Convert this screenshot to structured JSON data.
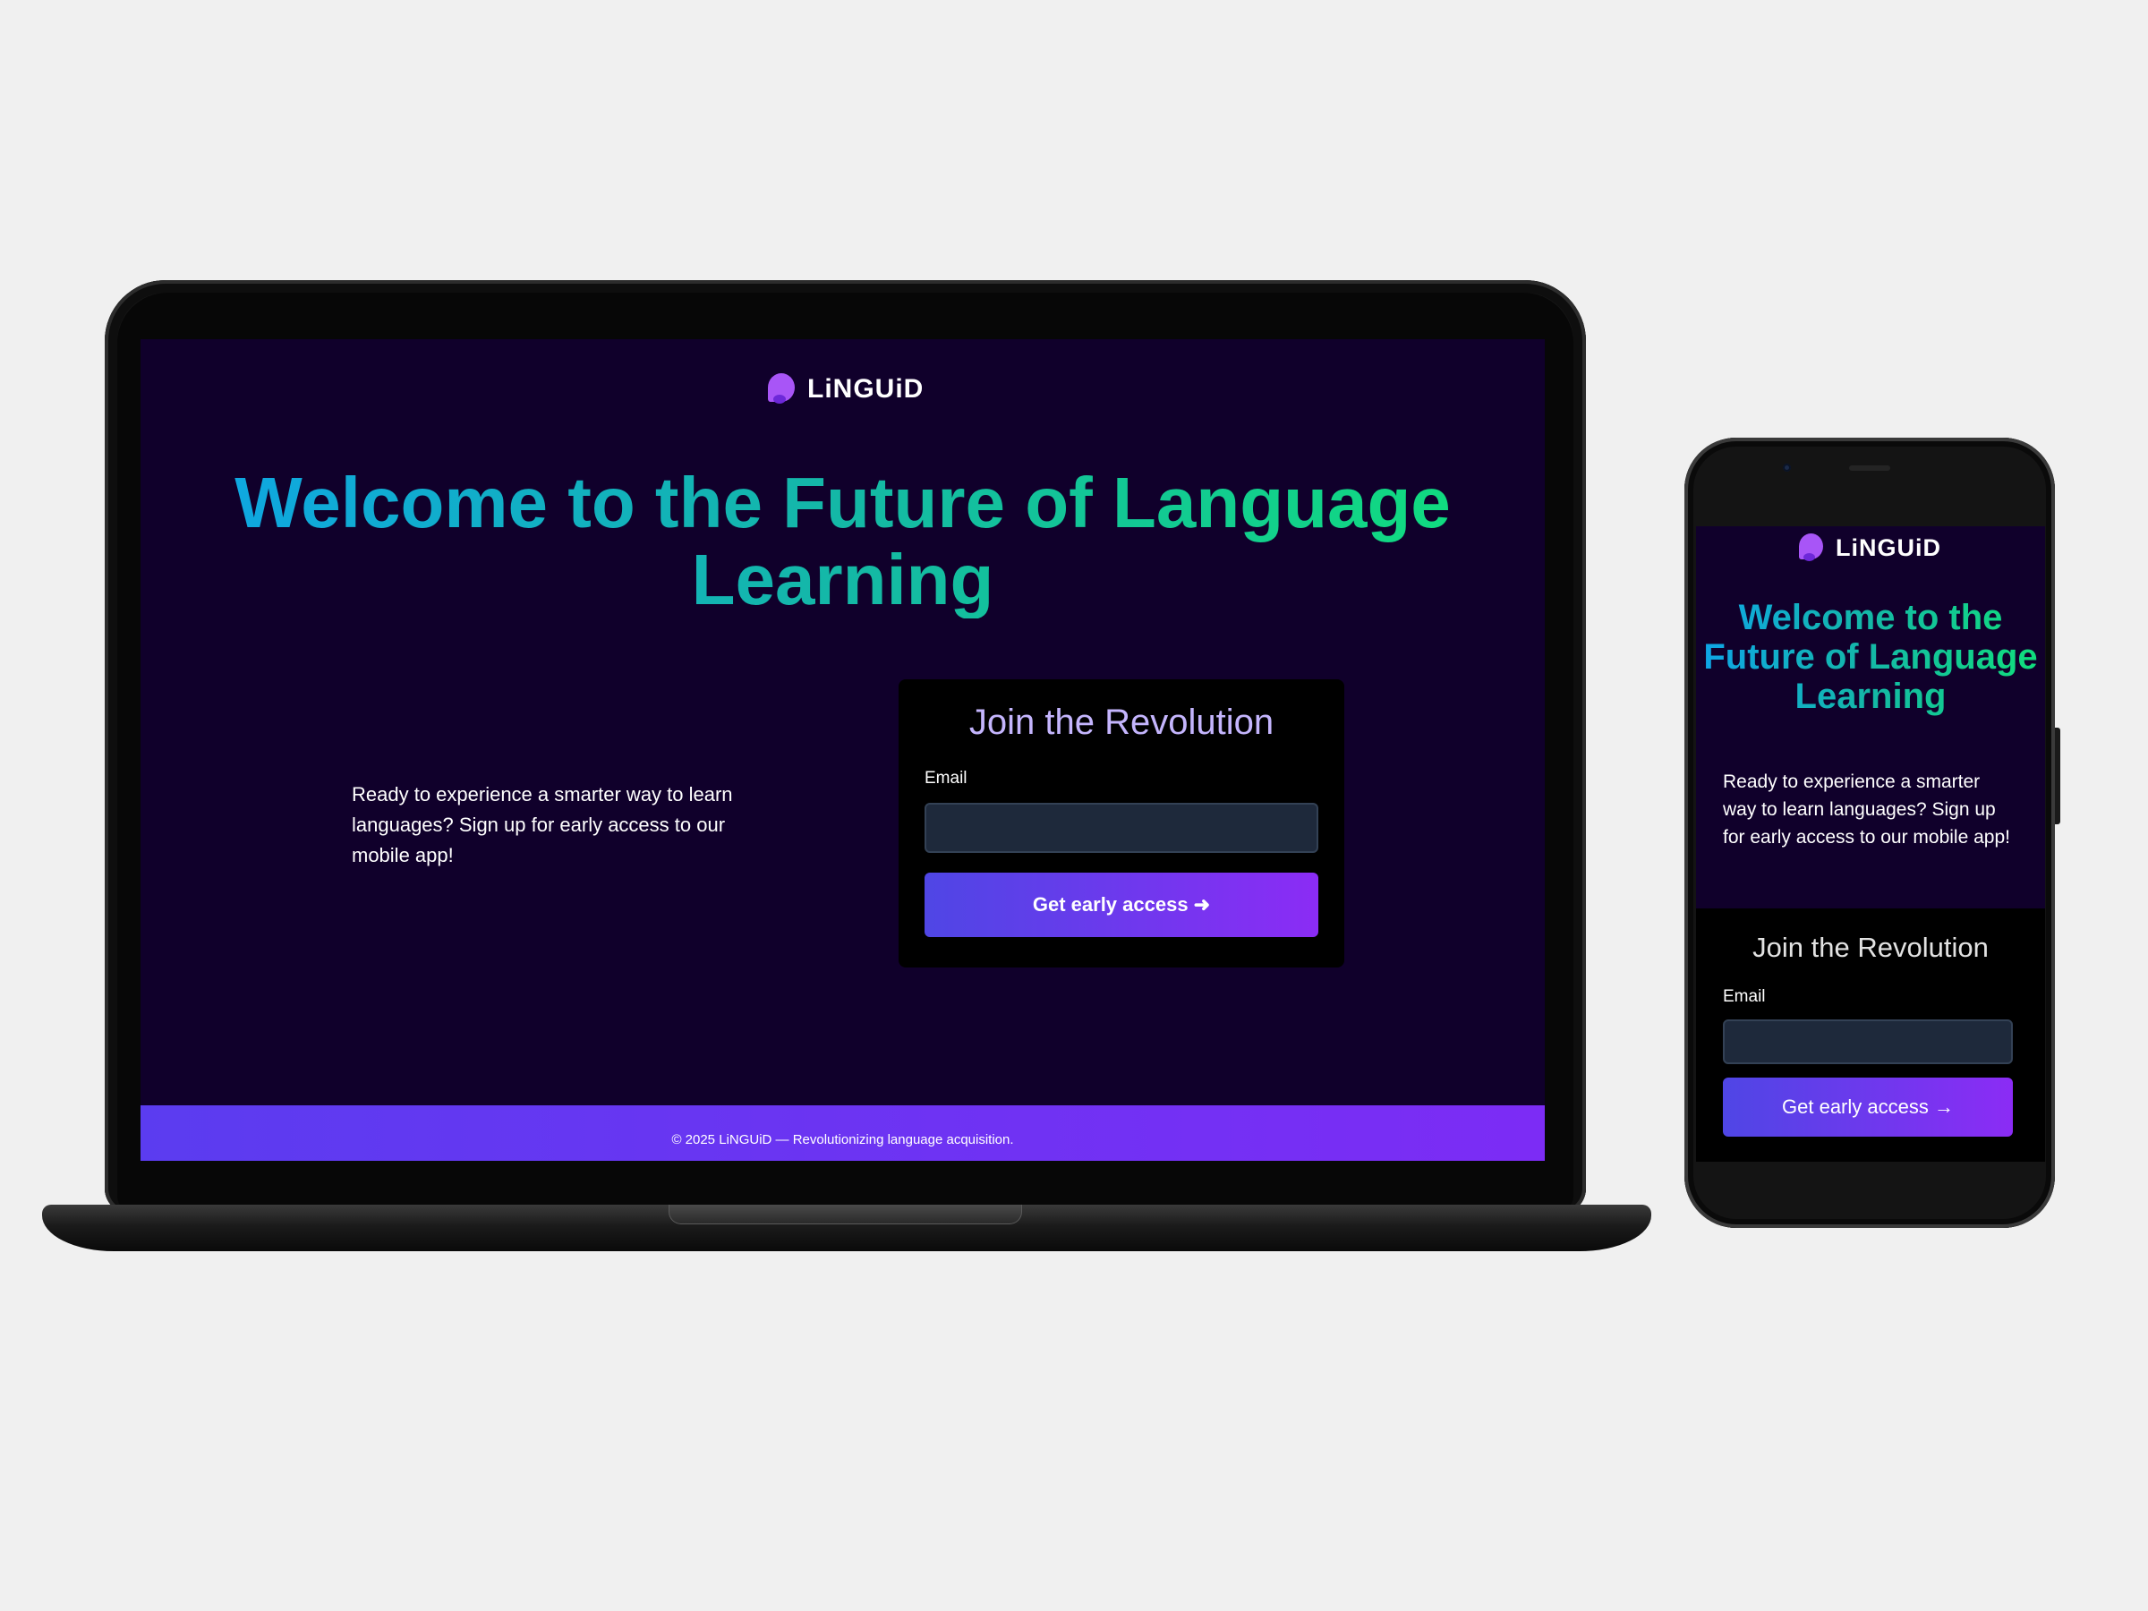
{
  "brand": {
    "name": "LiNGUiD",
    "logo_icon": "linguid-logo-icon",
    "accent": "#7c3aed",
    "background": "#10002b"
  },
  "laptop": {
    "hero_title": "Welcome to the Future of Language Learning",
    "description": "Ready to experience a smarter way to learn languages? Sign up for early access to our mobile app!",
    "signup": {
      "title": "Join the Revolution",
      "email_label": "Email",
      "email_value": "",
      "button_label": "Get early access ➜"
    },
    "footer_text": "© 2025 LiNGUiD — Revolutionizing language acquisition."
  },
  "phone": {
    "hero_title": "Welcome to the Future of Language Learning",
    "description": "Ready to experience a smarter way to learn languages? Sign up for early access to our mobile app!",
    "signup": {
      "title": "Join the Revolution",
      "email_label": "Email",
      "email_value": "",
      "button_label": "Get early access →"
    }
  }
}
